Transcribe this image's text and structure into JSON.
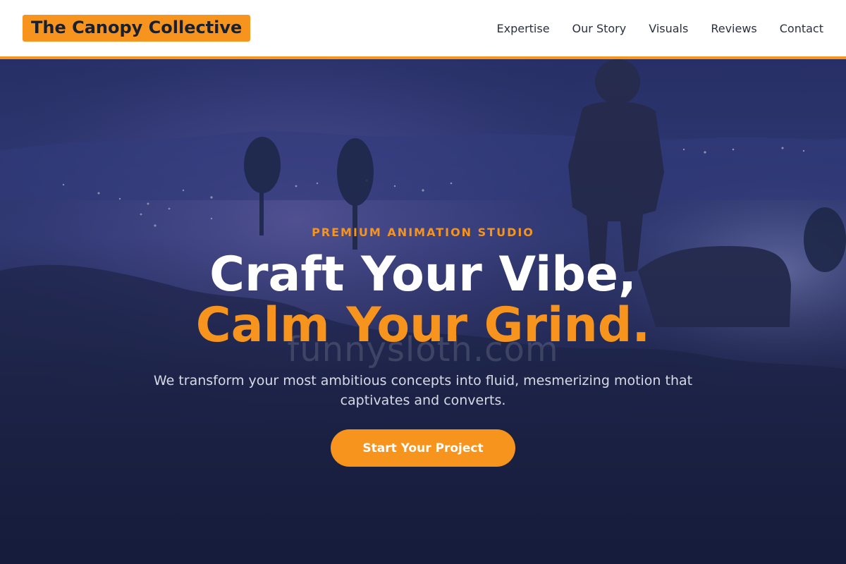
{
  "header": {
    "brand": "The Canopy Collective",
    "nav": [
      {
        "label": "Expertise"
      },
      {
        "label": "Our Story"
      },
      {
        "label": "Visuals"
      },
      {
        "label": "Reviews"
      },
      {
        "label": "Contact"
      }
    ]
  },
  "hero": {
    "eyebrow": "PREMIUM ANIMATION STUDIO",
    "headline_line1": "Craft Your Vibe,",
    "headline_line2": "Calm Your Grind.",
    "watermark": "funnysloth.com",
    "subtitle": "We transform your most ambitious concepts into fluid, mesmerizing motion that captivates and converts.",
    "cta_label": "Start Your Project"
  },
  "colors": {
    "accent": "#f7941d",
    "nav_bg": "#ffffff",
    "hero_overlay": "#1b2140"
  }
}
